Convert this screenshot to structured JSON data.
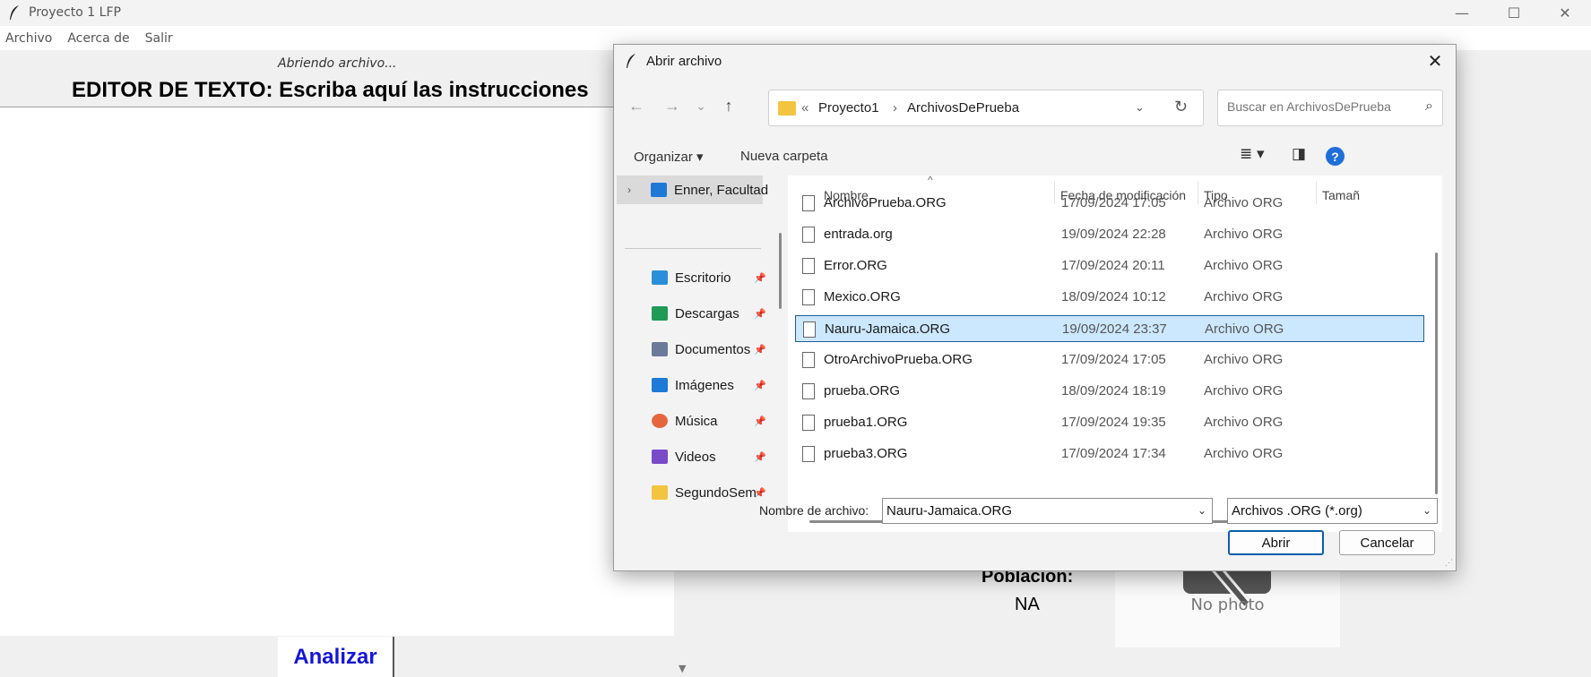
{
  "window": {
    "title": "Proyecto 1 LFP",
    "minimize_glyph": "—",
    "maximize_glyph": "☐",
    "close_glyph": "✕"
  },
  "menu": [
    "Archivo",
    "Acerca de",
    "Salir"
  ],
  "editor": {
    "status": "Abriendo archivo...",
    "title": "EDITOR DE TEXTO: Escriba aquí las instrucciones",
    "analyze_label": "Analizar"
  },
  "info": {
    "population_label": "Población:",
    "population_value": "NA",
    "photo_placeholder": "No photo"
  },
  "dialog": {
    "title": "Abrir archivo",
    "close_glyph": "✕",
    "nav": {
      "back": "←",
      "forward": "→",
      "recent": "⌄",
      "up": "↑"
    },
    "address": {
      "chevrons": "«",
      "crumbs": [
        "Proyecto1",
        "ArchivosDePrueba"
      ],
      "separator": "›"
    },
    "search_placeholder": "Buscar en ArchivosDePrueba",
    "toolbar": {
      "organize": "Organizar ▾",
      "new_folder": "Nueva carpeta"
    },
    "sidebar": [
      {
        "label": "Enner, Facultad",
        "icon": "onedrive-cloud-icon",
        "color": "#1e78d6",
        "pinned": false,
        "selected": true
      },
      {
        "label": "Escritorio",
        "icon": "desktop-icon",
        "color": "#2a8fd8",
        "pinned": true
      },
      {
        "label": "Descargas",
        "icon": "download-icon",
        "color": "#1f9a57",
        "pinned": true
      },
      {
        "label": "Documentos",
        "icon": "documents-icon",
        "color": "#6b7a99",
        "pinned": true
      },
      {
        "label": "Imágenes",
        "icon": "pictures-icon",
        "color": "#1d7ad6",
        "pinned": true
      },
      {
        "label": "Música",
        "icon": "music-icon",
        "color": "#e5663d",
        "pinned": true
      },
      {
        "label": "Videos",
        "icon": "videos-icon",
        "color": "#7a4ac9",
        "pinned": true
      },
      {
        "label": "SegundoSem",
        "icon": "folder-icon",
        "color": "#f3c440",
        "pinned": true
      }
    ],
    "columns": [
      "Nombre",
      "Fecha de modificación",
      "Tipo",
      "Tamañ"
    ],
    "files": [
      {
        "name": "ArchivoPrueba.ORG",
        "date": "17/09/2024 17:05",
        "type": "Archivo ORG",
        "selected": false
      },
      {
        "name": "entrada.org",
        "date": "19/09/2024 22:28",
        "type": "Archivo ORG",
        "selected": false
      },
      {
        "name": "Error.ORG",
        "date": "17/09/2024 20:11",
        "type": "Archivo ORG",
        "selected": false
      },
      {
        "name": "Mexico.ORG",
        "date": "18/09/2024 10:12",
        "type": "Archivo ORG",
        "selected": false
      },
      {
        "name": "Nauru-Jamaica.ORG",
        "date": "19/09/2024 23:37",
        "type": "Archivo ORG",
        "selected": true
      },
      {
        "name": "OtroArchivoPrueba.ORG",
        "date": "17/09/2024 17:05",
        "type": "Archivo ORG",
        "selected": false
      },
      {
        "name": "prueba.ORG",
        "date": "18/09/2024 18:19",
        "type": "Archivo ORG",
        "selected": false
      },
      {
        "name": "prueba1.ORG",
        "date": "17/09/2024 19:35",
        "type": "Archivo ORG",
        "selected": false
      },
      {
        "name": "prueba3.ORG",
        "date": "17/09/2024 17:34",
        "type": "Archivo ORG",
        "selected": false
      }
    ],
    "filename_label": "Nombre de archivo:",
    "filename_value": "Nauru-Jamaica.ORG",
    "filter_value": "Archivos .ORG (*.org)",
    "open_label": "Abrir",
    "cancel_label": "Cancelar"
  }
}
